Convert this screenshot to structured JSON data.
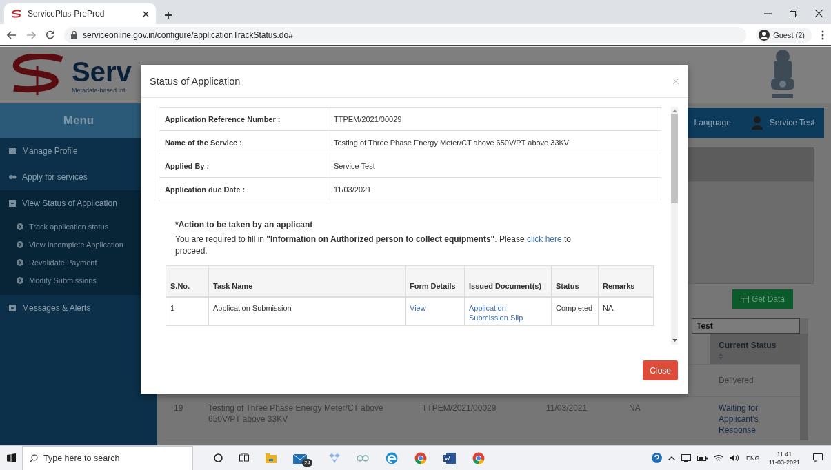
{
  "browser": {
    "tab_title": "ServicePlus-PreProd",
    "url": "serviceonline.gov.in/configure/applicationTrackStatus.do#",
    "profile": "Guest (2)"
  },
  "site_header": {
    "logo_text": "Serv",
    "tagline": "Metadata-based Int"
  },
  "navbar": {
    "language": "Language",
    "user": "Service Test"
  },
  "sidebar": {
    "title": "Menu",
    "items": [
      {
        "label": "Manage Profile",
        "selected": false
      },
      {
        "label": "Apply for services",
        "selected": false
      },
      {
        "label": "View Status of Application",
        "selected": true,
        "children": [
          {
            "label": "Track application status"
          },
          {
            "label": "View Incomplete Application"
          },
          {
            "label": "Revalidate Payment"
          },
          {
            "label": "Modify Submissions"
          }
        ]
      },
      {
        "label": "Messages & Alerts",
        "selected": false
      }
    ]
  },
  "applications": {
    "get_data_button": "Get Data",
    "filter_value": "Test",
    "status_header": "Current Status",
    "rows": [
      {
        "sno": "",
        "service": "",
        "reference": "",
        "date": "",
        "remarks": "",
        "status": "Delivered"
      },
      {
        "sno": "19",
        "service": "Testing of Three Phase Energy Meter/CT above 650V/PT above 33KV",
        "reference": "TTPEM/2021/00029",
        "date": "11/03/2021",
        "remarks": "NA",
        "status": "Waiting for Applicant's Response"
      }
    ]
  },
  "modal": {
    "title": "Status of Application",
    "details": [
      {
        "label": "Application Reference Number :",
        "value": "TTPEM/2021/00029"
      },
      {
        "label": "Name of the Service :",
        "value": "Testing of Three Phase Energy Meter/CT above 650V/PT above 33KV"
      },
      {
        "label": "Applied By :",
        "value": "Service Test"
      },
      {
        "label": "Application due Date :",
        "value": "11/03/2021"
      }
    ],
    "action_heading": "*Action to be taken by an applicant",
    "action_text": "You are required to fill in **\"Information on Authorized person to collect equipments\"**. Please",
    "action_link": "click here",
    "action_suffix": "to proceed.",
    "task_columns": [
      "S.No.",
      "Task Name",
      "Form Details",
      "Issued Document(s)",
      "Status",
      "Remarks"
    ],
    "tasks": [
      {
        "sno": "1",
        "task": "Application Submission",
        "form_details": "View",
        "issued_document": "Application Submission Slip",
        "status": "Completed",
        "remarks": "NA"
      }
    ],
    "close_button": "Close"
  },
  "taskbar": {
    "search_placeholder": "Type here to search",
    "mail_badge": "24",
    "language": "ENG",
    "time": "11:41",
    "date": "11-03-2021"
  }
}
